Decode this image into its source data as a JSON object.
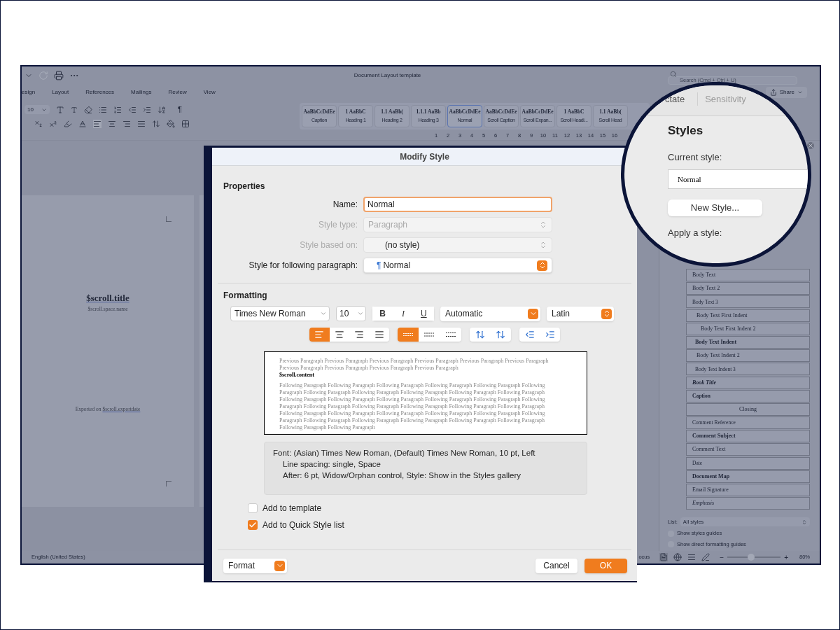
{
  "window": {
    "title": "Document Layout template",
    "search_placeholder": "Search (Cmd + Ctrl + U)",
    "share": "Share"
  },
  "ribbon_tabs": [
    {
      "label": "esign",
      "selected": false
    },
    {
      "label": "Layout",
      "selected": false
    },
    {
      "label": "References",
      "selected": false
    },
    {
      "label": "Mailings",
      "selected": false
    },
    {
      "label": "Review",
      "selected": false
    },
    {
      "label": "View",
      "selected": false
    }
  ],
  "toolbar": {
    "font_size": "10",
    "pilcrow": "¶"
  },
  "styles_gallery": [
    {
      "sample": "AaBbCcDdEe",
      "label": "Caption",
      "selected": false
    },
    {
      "sample": "1  AaBbC",
      "label": "Heading 1",
      "selected": false
    },
    {
      "sample": "1.1  AaBb(",
      "label": "Heading 2",
      "selected": false
    },
    {
      "sample": "1.1.1  AaBb",
      "label": "Heading 3",
      "selected": false
    },
    {
      "sample": "AaBbCcDdEe",
      "label": "Normal",
      "selected": true
    },
    {
      "sample": "AaBbCcDdEe",
      "label": "Scroll Caption",
      "selected": false
    },
    {
      "sample": "AaBbCcDdEe",
      "label": "Scroll Expan...",
      "selected": false
    },
    {
      "sample": "1  AaBbC",
      "label": "Scroll Headi...",
      "selected": false
    },
    {
      "sample": "1.1  AaBb(",
      "label": "Scroll Head",
      "selected": false
    }
  ],
  "ruler": [
    "1",
    "2",
    "3",
    "4",
    "5",
    "6",
    "7",
    "8",
    "9",
    "10",
    "11",
    "12",
    "13",
    "14",
    "15",
    "16"
  ],
  "document": {
    "title": "$scroll.title",
    "subtitle": "$scroll.space.name",
    "footer_prefix": "Exported on ",
    "footer_link": "$scroll.exportdate"
  },
  "styles_pane": {
    "items": [
      {
        "label": "Body Text",
        "kind": "plain"
      },
      {
        "label": "Body Text 2",
        "kind": "plain"
      },
      {
        "label": "Body Text 3",
        "kind": "small"
      },
      {
        "label": "Body Text First Indent",
        "kind": "indent"
      },
      {
        "label": "Body Text First Indent 2",
        "kind": "indent2"
      },
      {
        "label": "Body Text Indent",
        "kind": "bold-indent"
      },
      {
        "label": "Body Text Indent 2",
        "kind": "indent"
      },
      {
        "label": "Body Text Indent 3",
        "kind": "small-indent"
      },
      {
        "label": "Book Title",
        "kind": "bold-italic"
      },
      {
        "label": "Caption",
        "kind": "small-bold"
      },
      {
        "label": "Closing",
        "kind": "center"
      },
      {
        "label": "Comment Reference",
        "kind": "small"
      },
      {
        "label": "Comment Subject",
        "kind": "bold"
      },
      {
        "label": "Comment Text",
        "kind": "plain"
      },
      {
        "label": "Date",
        "kind": "small"
      },
      {
        "label": "Document Map",
        "kind": "sans-bold"
      },
      {
        "label": "Email Signature",
        "kind": "plain"
      },
      {
        "label": "Emphasis",
        "kind": "italic"
      }
    ],
    "list_label": "List:",
    "list_value": "All styles",
    "options": [
      {
        "label": "Show styles guides",
        "checked": false
      },
      {
        "label": "Show direct formatting guides",
        "checked": false
      }
    ]
  },
  "status_bar": {
    "language": "English (United States)",
    "focus": "ocus",
    "zoom_out": "−",
    "zoom_in": "+",
    "zoom": "80%",
    "zoom_slider": {
      "level": 0.45
    }
  },
  "magnifier": {
    "tabs": [
      {
        "label": "ctate",
        "selected": false
      },
      {
        "label": "Sensitivity",
        "selected": false
      }
    ],
    "title": "Styles",
    "current_style_label": "Current style:",
    "current_style": "Normal",
    "new_style_button": "New Style...",
    "apply_label": "Apply a style:"
  },
  "dialog": {
    "title": "Modify Style",
    "properties_heading": "Properties",
    "fields": [
      {
        "label": "Name:",
        "value": "Normal",
        "kind": "text",
        "disabled": false
      },
      {
        "label": "Style type:",
        "value": "Paragraph",
        "kind": "select",
        "disabled": true
      },
      {
        "label": "Style based on:",
        "value": "(no style)",
        "kind": "select",
        "disabled": true
      },
      {
        "label": "Style for following paragraph:",
        "value": "Normal",
        "kind": "popup",
        "disabled": false,
        "mark": "¶"
      }
    ],
    "formatting_heading": "Formatting",
    "font": "Times New Roman",
    "size": "10",
    "text_styles": [
      {
        "label": "B",
        "selected": false
      },
      {
        "label": "I",
        "selected": false
      },
      {
        "label": "U",
        "selected": false
      }
    ],
    "font_color_name": "Automatic",
    "script": "Latin",
    "alignment": [
      {
        "selected": true
      },
      {
        "selected": false
      },
      {
        "selected": false
      },
      {
        "selected": false
      }
    ],
    "line_spacing": [
      {
        "selected": true
      },
      {
        "selected": false
      },
      {
        "selected": false
      }
    ],
    "preview": {
      "previous": "Previous Paragraph Previous Paragraph Previous Paragraph Previous Paragraph Previous Paragraph Previous Paragraph Previous Paragraph Previous Paragraph Previous Paragraph Previous Paragraph",
      "sample": "$scroll.content",
      "following": "Following Paragraph Following Paragraph Following Paragraph Following Paragraph Following Paragraph Following Paragraph Following Paragraph Following Paragraph Following Paragraph Following Paragraph Following Paragraph Following Paragraph Following Paragraph Following Paragraph Following Paragraph Following Paragraph Following Paragraph Following Paragraph Following Paragraph Following Paragraph Following Paragraph Following Paragraph Following Paragraph Following Paragraph Following Paragraph Following Paragraph Following Paragraph Following Paragraph Following Paragraph Following Paragraph Following Paragraph Following Paragraph Following Paragraph Following Paragraph Following Paragraph"
    },
    "description": [
      "Font: (Asian) Times New Roman, (Default) Times New Roman, 10 pt, Left",
      "Line spacing:  single, Space",
      "After:  6 pt, Widow/Orphan control, Style: Show in the Styles gallery"
    ],
    "checkboxes": [
      {
        "label": "Add to template",
        "checked": false
      },
      {
        "label": "Add to Quick Style list",
        "checked": true
      }
    ],
    "format_button": "Format",
    "cancel": "Cancel",
    "ok": "OK"
  }
}
